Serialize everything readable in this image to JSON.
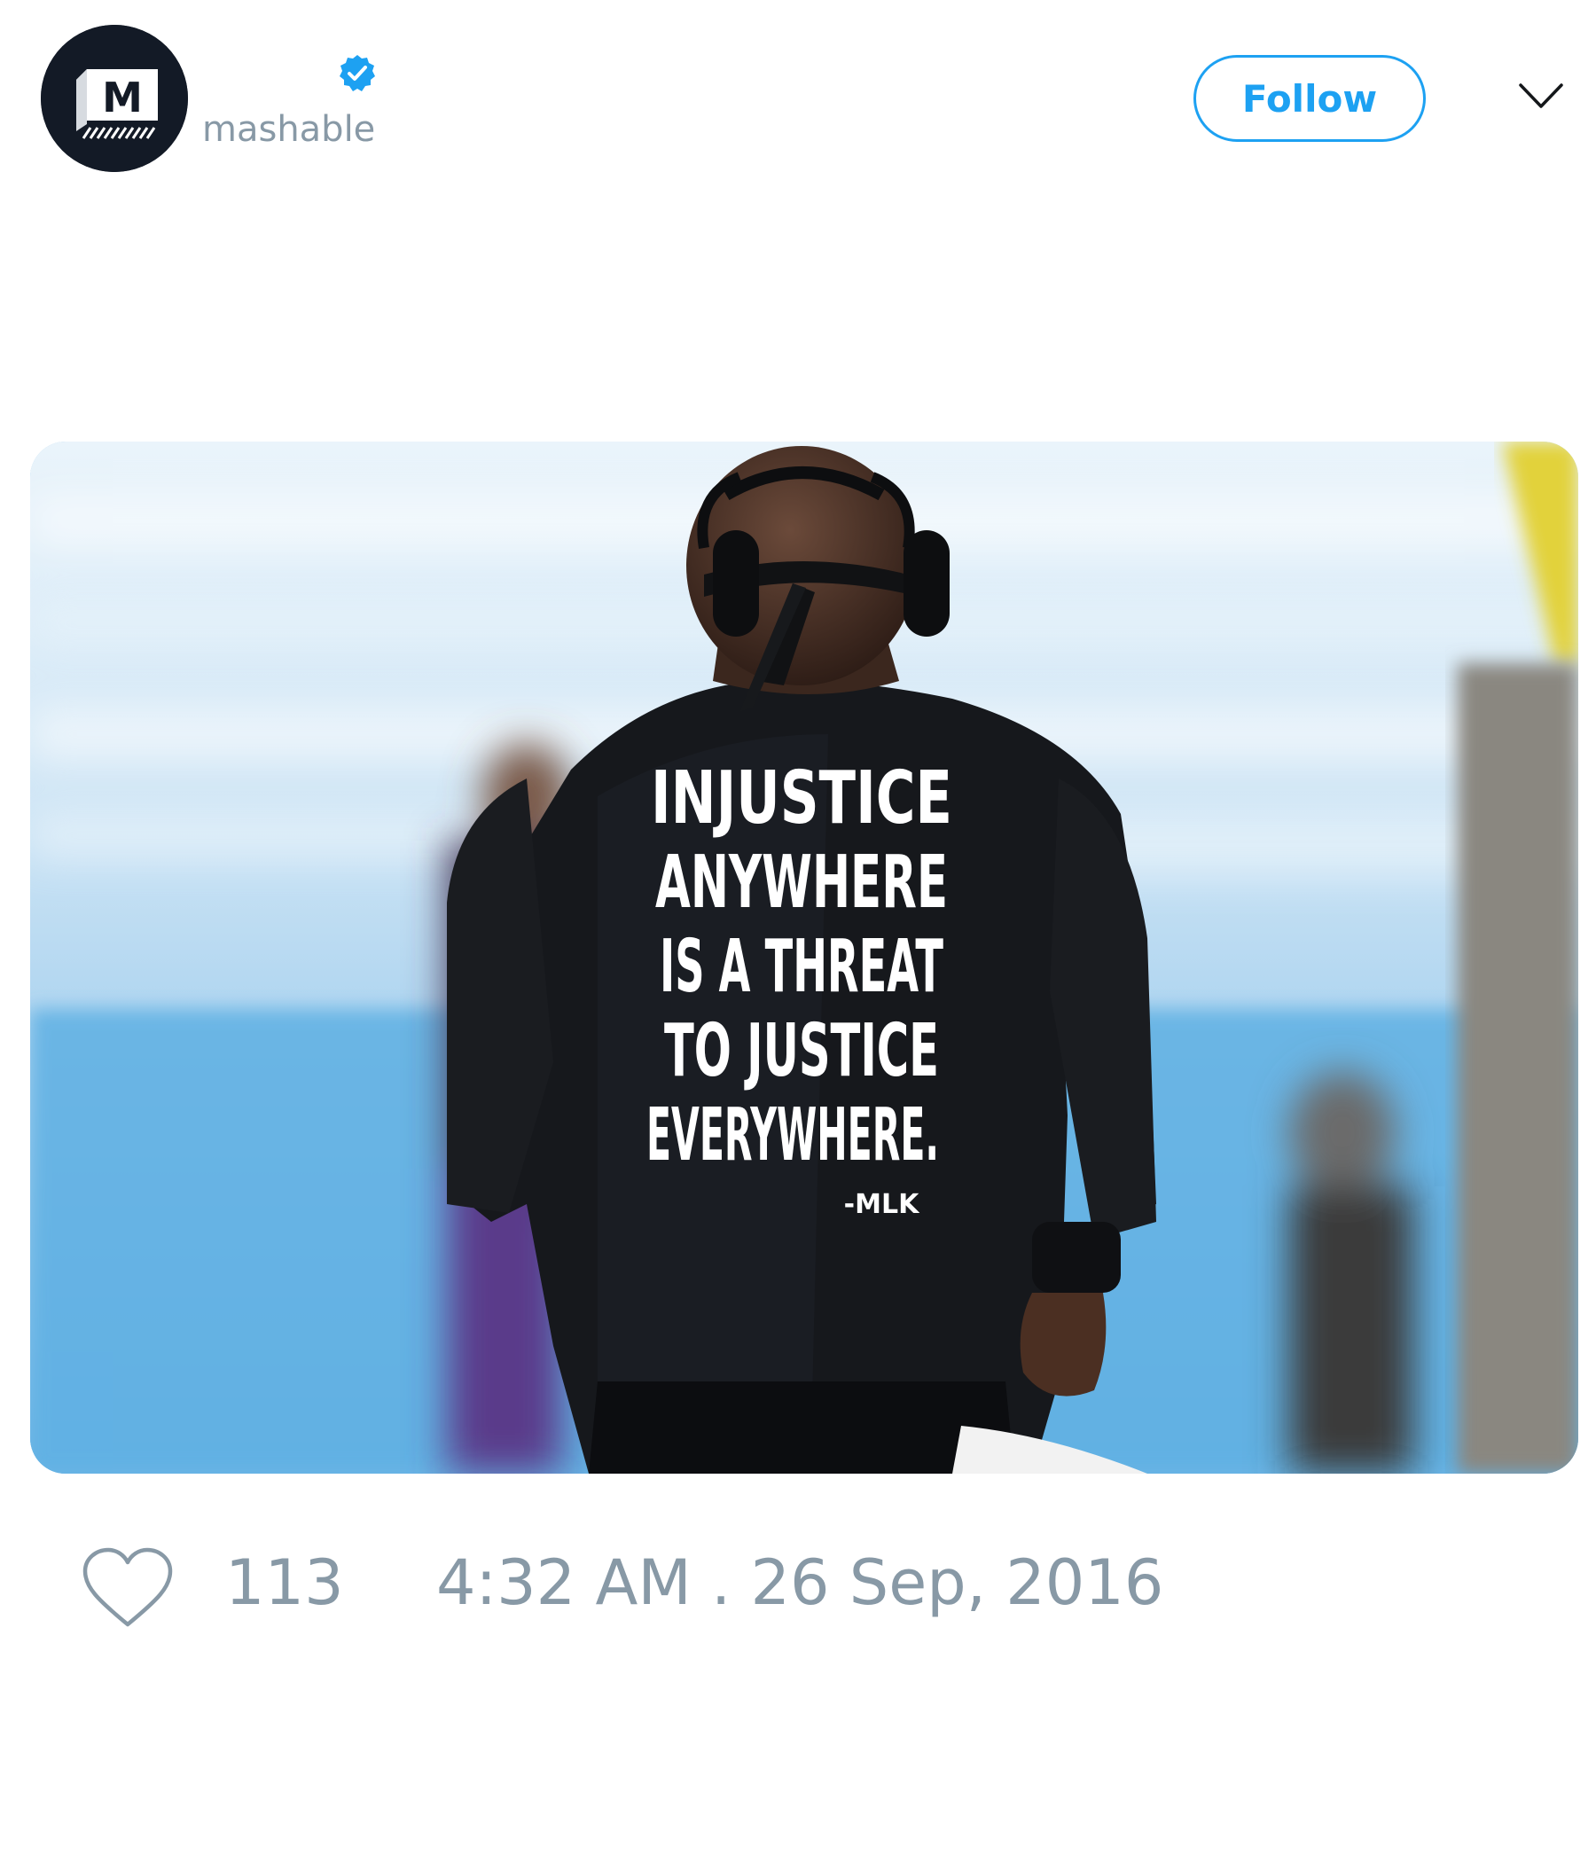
{
  "author": {
    "handle": "mashable",
    "avatar_icon": "mashable-logo-icon",
    "avatar_letter": "M",
    "verified_icon": "verified-badge-icon"
  },
  "header": {
    "follow_label": "Follow",
    "menu_icon": "chevron-down-icon"
  },
  "media": {
    "shirt_lines": [
      "INJUSTICE",
      "ANYWHERE",
      "IS A THREAT",
      "TO JUSTICE",
      "EVERYWHERE."
    ],
    "shirt_attribution": "-MLK"
  },
  "footer": {
    "like_icon": "heart-icon",
    "like_count": "113",
    "timestamp": "4:32 AM . 26 Sep, 2016"
  },
  "colors": {
    "accent": "#1da1f2",
    "muted_text": "#8899a6",
    "avatar_bg": "#131a26"
  }
}
